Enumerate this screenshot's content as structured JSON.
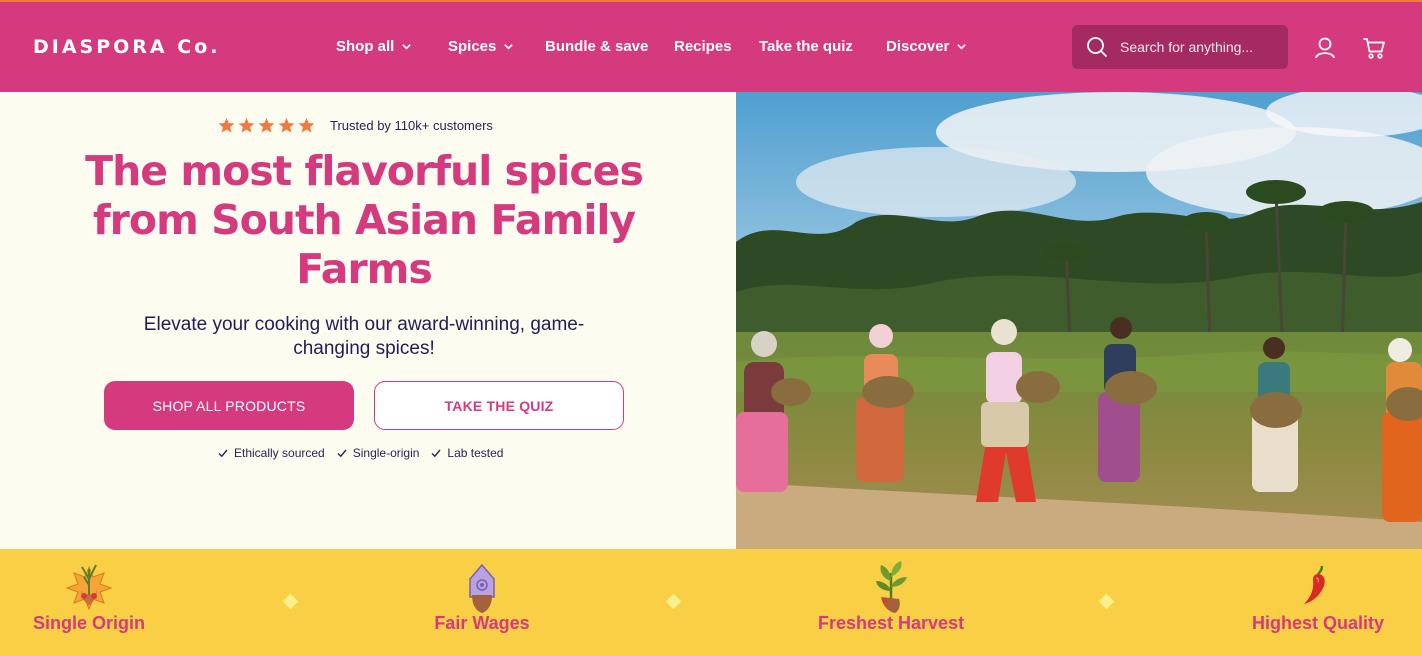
{
  "brand": {
    "logo_text": "DIASPORA Co.",
    "primary_color": "#d63a7e",
    "accent_color": "#f0793f",
    "band_color": "#f9cf45"
  },
  "nav": {
    "items": [
      {
        "label": "Shop all",
        "has_dropdown": true
      },
      {
        "label": "Spices",
        "has_dropdown": true
      },
      {
        "label": "Bundle & save",
        "has_dropdown": false
      },
      {
        "label": "Recipes",
        "has_dropdown": false
      },
      {
        "label": "Take the quiz",
        "has_dropdown": false
      },
      {
        "label": "Discover",
        "has_dropdown": true
      }
    ],
    "search_placeholder": "Search for anything...",
    "icons": [
      "search-icon",
      "account-icon",
      "cart-icon"
    ]
  },
  "hero": {
    "rating_stars": 5,
    "trust_text": "Trusted by 110k+ customers",
    "title": "The most flavorful spices from South Asian Family Farms",
    "subtitle": "Elevate your cooking with our award-winning, game-changing spices!",
    "primary_cta": "SHOP ALL PRODUCTS",
    "secondary_cta": "TAKE THE QUIZ",
    "checks": [
      "Ethically sourced",
      "Single-origin",
      "Lab tested"
    ]
  },
  "values": [
    {
      "label": "Single Origin",
      "icon": "hands-holding-plant-icon"
    },
    {
      "label": "Fair Wages",
      "icon": "hand-holding-house-icon"
    },
    {
      "label": "Freshest Harvest",
      "icon": "hand-holding-sprout-icon"
    },
    {
      "label": "Highest Quality",
      "icon": "chili-pepper-icon"
    }
  ]
}
